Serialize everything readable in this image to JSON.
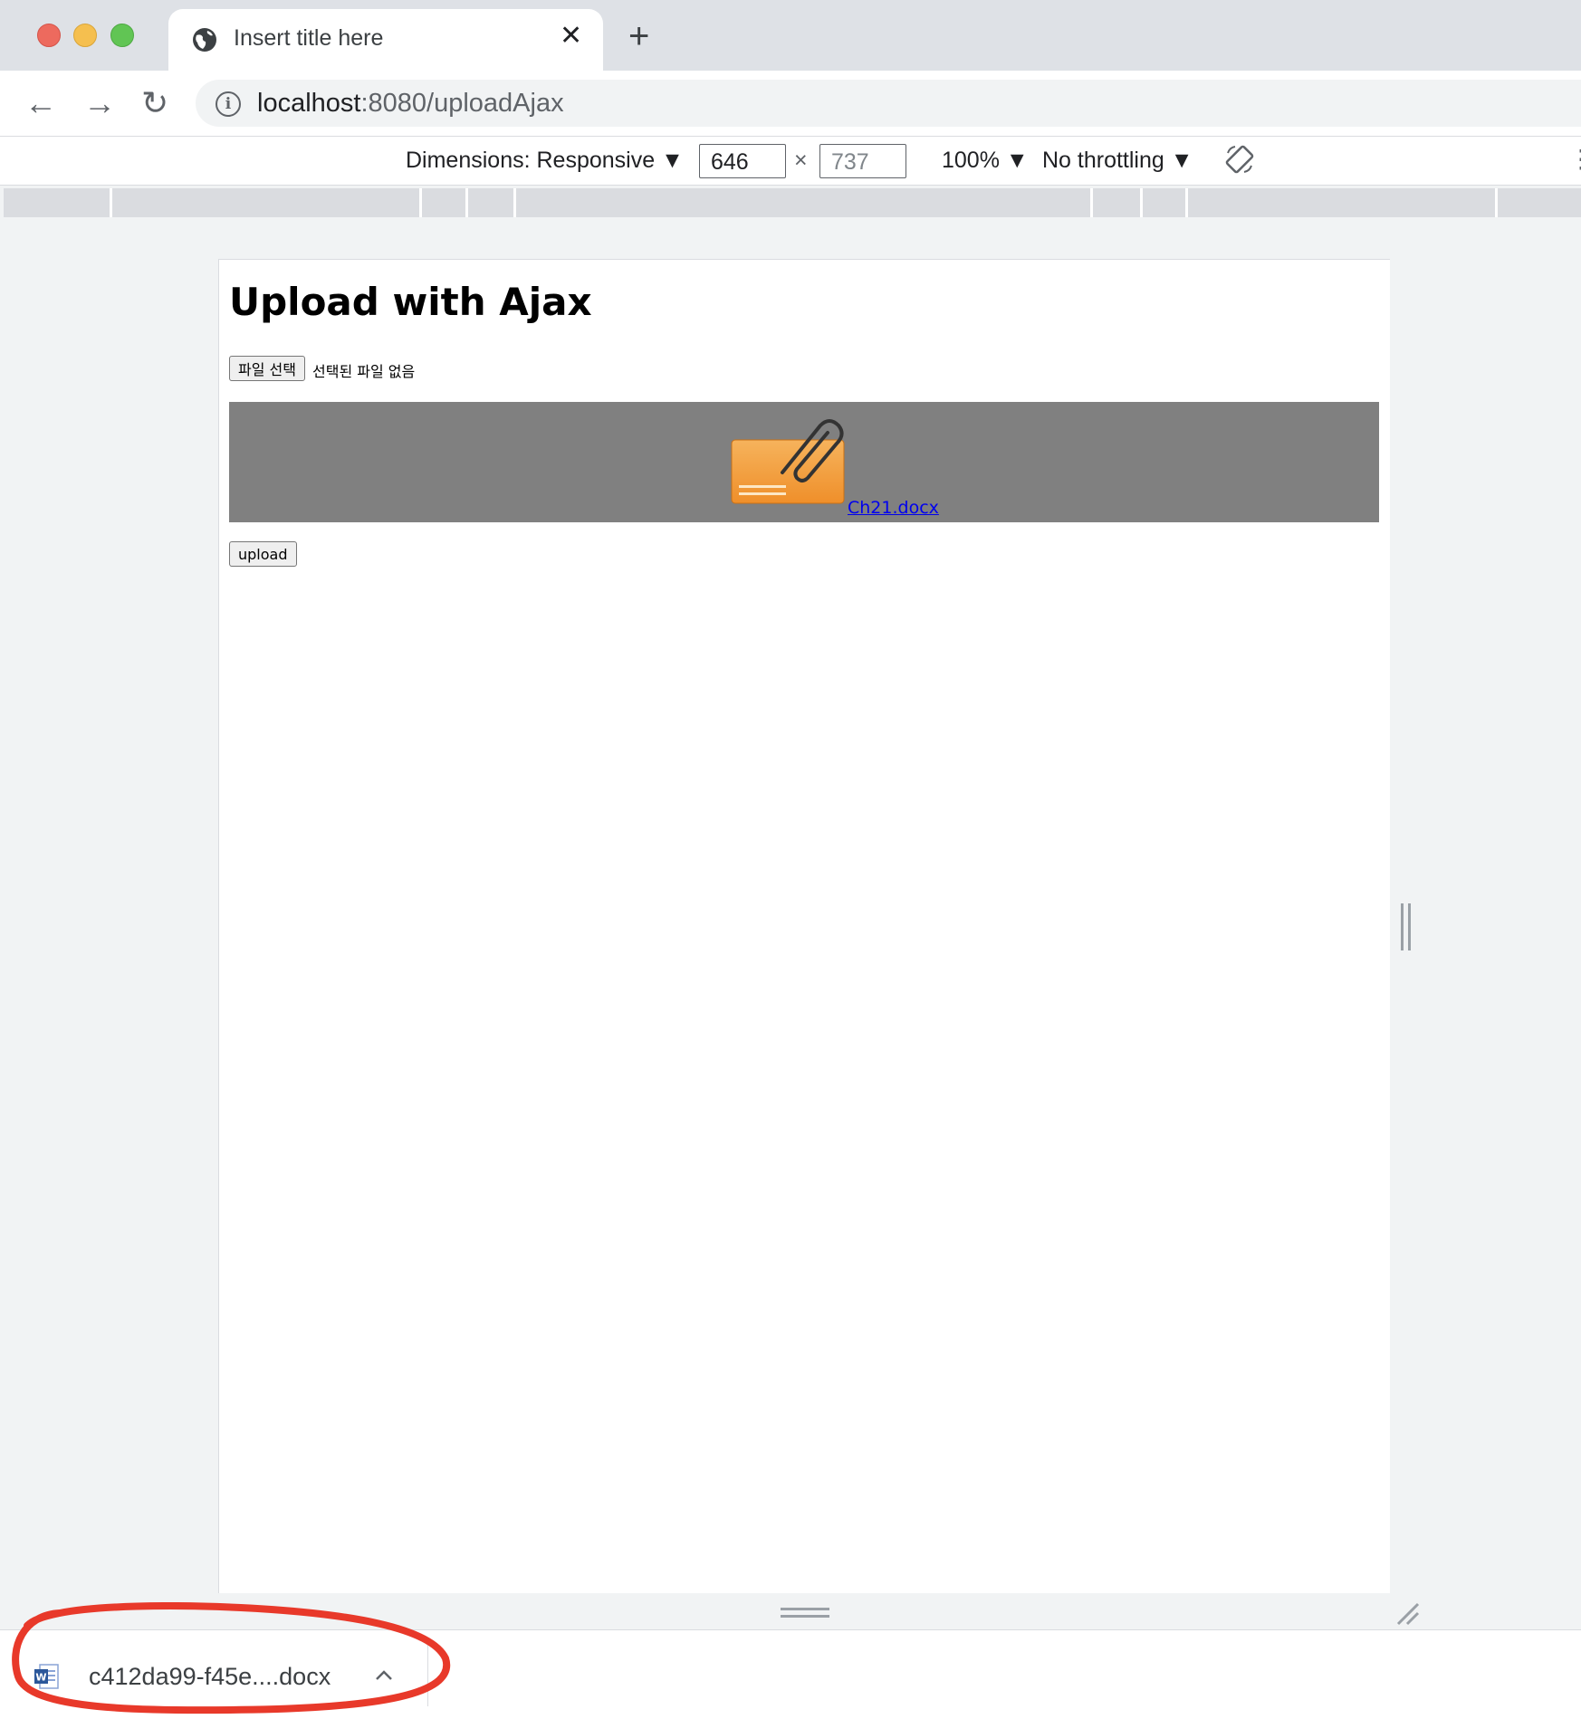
{
  "tab": {
    "title": "Insert title here"
  },
  "address_bar": {
    "host": "localhost",
    "rest": ":8080/uploadAjax"
  },
  "device_toolbar": {
    "dimensions_label": "Dimensions: Responsive",
    "width": "646",
    "height": "737",
    "separator": "×",
    "zoom": "100%",
    "throttling": "No throttling"
  },
  "page": {
    "heading": "Upload with Ajax",
    "file_button_label": "파일 선택",
    "file_status": "선택된 파일 없음",
    "uploaded_file_link": "Ch21.docx",
    "upload_button_label": "upload"
  },
  "download_shelf": {
    "filename": "c412da99-f45e....docx"
  },
  "colors": {
    "tab_strip": "#dee1e6",
    "upload_result_bg": "#808080",
    "link": "#0000ee",
    "annotation": "#e8392a"
  }
}
